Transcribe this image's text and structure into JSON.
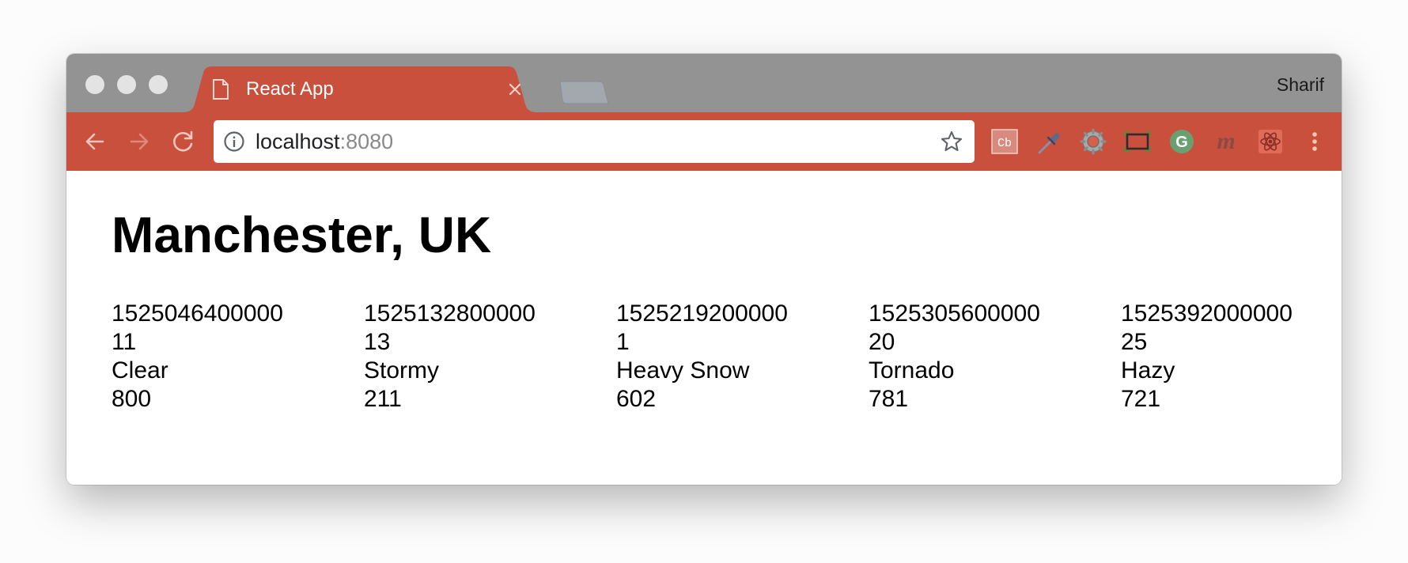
{
  "window": {
    "tab_title": "React App",
    "profile_name": "Sharif"
  },
  "address_bar": {
    "host": "localhost",
    "port": ":8080"
  },
  "extensions": [
    {
      "name": "cb-extension-icon",
      "label": "Cb"
    },
    {
      "name": "eyedropper-extension-icon"
    },
    {
      "name": "settings-gear-extension-icon"
    },
    {
      "name": "screenshot-frame-extension-icon"
    },
    {
      "name": "grammarly-extension-icon",
      "label": "G"
    },
    {
      "name": "m-extension-icon",
      "label": "m"
    },
    {
      "name": "react-devtools-extension-icon"
    }
  ],
  "colors": {
    "titlebar": "#939393",
    "accent": "#c9503d",
    "content_background": "#ffffff"
  },
  "page": {
    "heading": "Manchester, UK",
    "forecast": [
      {
        "timestamp": "1525046400000",
        "temperature": "11",
        "condition": "Clear",
        "code": "800"
      },
      {
        "timestamp": "1525132800000",
        "temperature": "13",
        "condition": "Stormy",
        "code": "211"
      },
      {
        "timestamp": "1525219200000",
        "temperature": "1",
        "condition": "Heavy Snow",
        "code": "602"
      },
      {
        "timestamp": "1525305600000",
        "temperature": "20",
        "condition": "Tornado",
        "code": "781"
      },
      {
        "timestamp": "1525392000000",
        "temperature": "25",
        "condition": "Hazy",
        "code": "721"
      }
    ]
  }
}
